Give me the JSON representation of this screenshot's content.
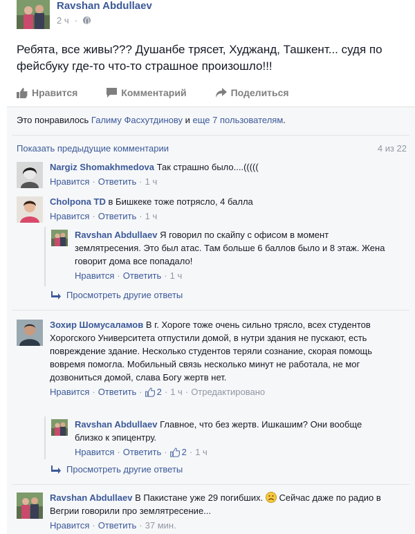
{
  "post": {
    "author": "Ravshan Abdullaev",
    "time": "2 ч",
    "text": "Ребята, все живы??? Душанбе трясет, Худжанд, Ташкент... судя по фейсбуку где-то что-то страшное произошло!!!"
  },
  "actions": {
    "like": "Нравится",
    "comment": "Комментарий",
    "share": "Поделиться"
  },
  "likes": {
    "prefix": "Это понравилось ",
    "person": "Галиму Фасхутдинову",
    "and": " и ",
    "others": "еще 7 пользователям",
    "suffix": "."
  },
  "comments_header": {
    "show_previous": "Показать предыдущие комментарии",
    "counter": "4 из 22"
  },
  "labels": {
    "like": "Нравится",
    "reply": "Ответить",
    "more_replies": "Просмотреть другие ответы",
    "edited": "Отредактировано"
  },
  "comments": [
    {
      "author": "Nargiz Shomakhmedova",
      "text": "Так страшно было....(((((",
      "time": "1 ч"
    },
    {
      "author": "Cholpona TD",
      "text": "в Бишкеке тоже потрясло, 4 балла",
      "time": "1 ч",
      "reply": {
        "author": "Ravshan Abdullaev",
        "text": "Я говорил по скайпу с офисом в момент землятресения. Это был атас. Там больше 6 баллов было и 8 этаж. Жена говорит дома все попадало!",
        "time": "1 ч"
      }
    },
    {
      "author": "Зохир Шомусаламов",
      "text": "В г. Хороге тоже очень сильно трясло, всех студентов Хорогского Университета отпустили домой, в нутри здания не пускают, есть повреждение здание. Несколько студентов теряли сознание, скорая помощь вовремя помогла. Мобильный связь несколько минут не работала, не мог дозвониться домой, слава Богу жертв нет.",
      "time": "1 ч",
      "likes": "2",
      "reply": {
        "author": "Ravshan Abdullaev",
        "text": "Главное, что без жертв. Ишкашим? Они вообще близко к эпицентру.",
        "time": "1 ч",
        "likes": "2"
      }
    },
    {
      "author": "Ravshan Abdullaev",
      "text": "В Пакистане уже 29 погибших.",
      "text2": " Сейчас даже по радио в Вегрии говорили про землятресение...",
      "time": "37 мин."
    }
  ]
}
